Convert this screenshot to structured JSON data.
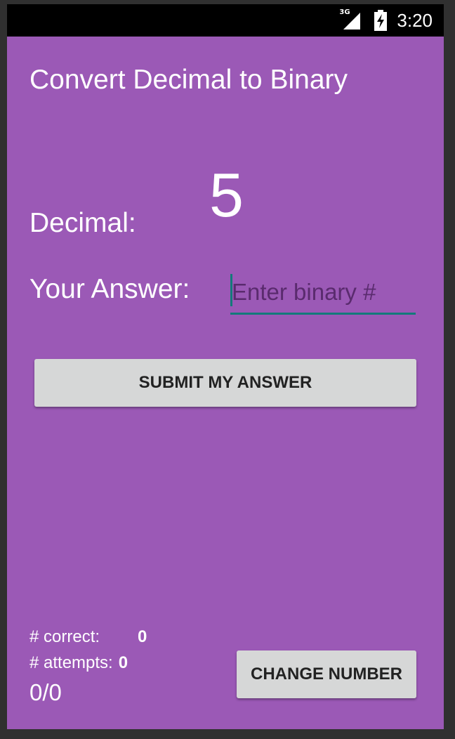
{
  "status_bar": {
    "network_type": "3G",
    "time": "3:20"
  },
  "app": {
    "title": "Convert Decimal to Binary",
    "background_color": "#9b59b6",
    "decimal_label": "Decimal:",
    "decimal_value": "5",
    "answer_label": "Your Answer:",
    "answer_input": {
      "value": "",
      "placeholder": "Enter binary #"
    },
    "submit_button_label": "SUBMIT MY ANSWER",
    "stats": {
      "correct_label": "# correct:",
      "correct_value": "0",
      "attempts_label": "# attempts:",
      "attempts_value": "0",
      "ratio": "0/0"
    },
    "change_number_button_label": "CHANGE NUMBER"
  }
}
